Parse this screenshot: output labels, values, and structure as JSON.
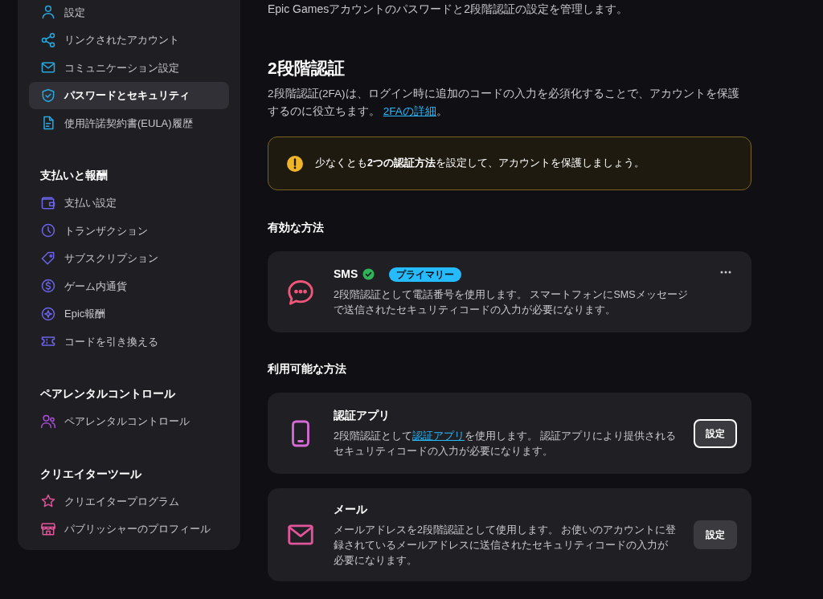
{
  "sidebar": {
    "sections": [
      {
        "items": [
          {
            "label": "設定",
            "kind": "user",
            "selected": false
          },
          {
            "label": "リンクされたアカウント",
            "kind": "share",
            "selected": false
          },
          {
            "label": "コミュニケーション設定",
            "kind": "mail",
            "selected": false
          },
          {
            "label": "パスワードとセキュリティ",
            "kind": "shield",
            "selected": true
          },
          {
            "label": "使用許諾契約書(EULA)履歴",
            "kind": "document",
            "selected": false
          }
        ]
      },
      {
        "heading": "支払いと報酬",
        "items": [
          {
            "label": "支払い設定",
            "kind": "wallet",
            "selected": false
          },
          {
            "label": "トランザクション",
            "kind": "clock",
            "selected": false
          },
          {
            "label": "サブスクリプション",
            "kind": "tag",
            "selected": false
          },
          {
            "label": "ゲーム内通貨",
            "kind": "coin",
            "selected": false
          },
          {
            "label": "Epic報酬",
            "kind": "sparkle",
            "selected": false
          },
          {
            "label": "コードを引き換える",
            "kind": "ticket",
            "selected": false
          }
        ]
      },
      {
        "heading": "ペアレンタルコントロール",
        "items": [
          {
            "label": "ペアレンタルコントロール",
            "kind": "users",
            "selected": false
          }
        ]
      },
      {
        "heading": "クリエイターツール",
        "items": [
          {
            "label": "クリエイタープログラム",
            "kind": "star",
            "selected": false
          },
          {
            "label": "パブリッシャーのプロフィール",
            "kind": "store",
            "selected": false
          }
        ]
      }
    ]
  },
  "main": {
    "intro": "Epic Gamesアカウントのパスワードと2段階認証の設定を管理します。",
    "title": "2段階認証",
    "description": {
      "before": "2段階認証(2FA)は、ログイン時に追加のコードの入力を必須化することで、アカウントを保護するのに役立ちます。 ",
      "link": "2FAの詳細",
      "after": "。"
    },
    "alert": "少なくとも**2つの認証方法**を設定して、アカウントを保護しましょう。",
    "groups": [
      {
        "heading": "有効な方法",
        "methods": [
          {
            "kind": "sms",
            "name": "SMS",
            "verified": true,
            "badge": "プライマリー",
            "description": {
              "before": "2段階認証として電話番号を使用します。 スマートフォンにSMSメッセージで送信されたセキュリティコードの入力が必要になります。"
            }
          }
        ]
      },
      {
        "heading": "利用可能な方法",
        "methods": [
          {
            "kind": "app",
            "name": "認証アプリ",
            "verified": false,
            "description": {
              "before": "2段階認証として",
              "link": "認証アプリ",
              "after": "を使用します。 認証アプリにより提供されるセキュリティコードの入力が必要になります。"
            },
            "button": {
              "label": "設定",
              "focused": true
            }
          },
          {
            "kind": "mail",
            "name": "メール",
            "verified": false,
            "description": {
              "before": "メールアドレスを2段階認証として使用します。 お使いのアカウントに登録されているメールアドレスに送信されたセキュリティコードの入力が必要になります。"
            },
            "button": {
              "label": "設定",
              "focused": false
            }
          }
        ]
      }
    ]
  }
}
